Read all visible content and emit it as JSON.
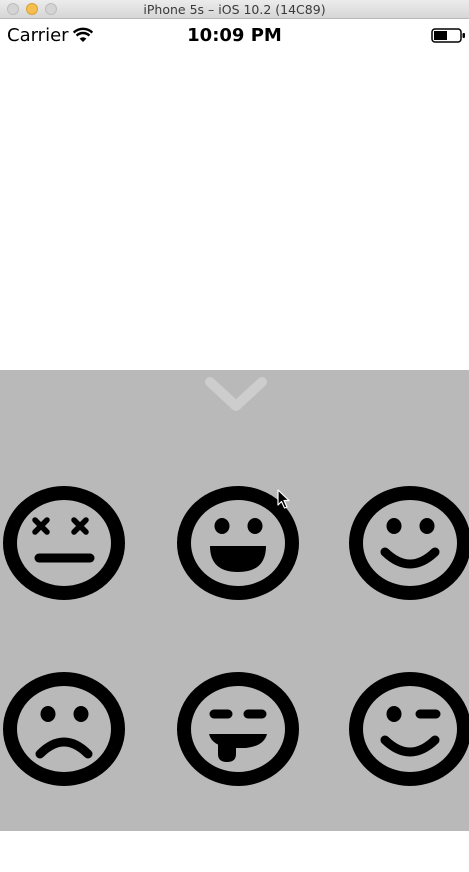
{
  "window": {
    "title": "iPhone 5s – iOS 10.2 (14C89)"
  },
  "status_bar": {
    "carrier": "Carrier",
    "time": "10:09 PM",
    "wifi_icon": "wifi-icon",
    "battery_icon": "battery-icon"
  },
  "picker": {
    "background_color": "#b9b9b9",
    "collapse_icon": "chevron-down-icon",
    "emojis": [
      {
        "name": "dizzy-face-icon"
      },
      {
        "name": "grinning-face-icon"
      },
      {
        "name": "smiling-face-icon"
      },
      {
        "name": "frowning-face-icon"
      },
      {
        "name": "tongue-out-face-icon"
      },
      {
        "name": "winking-face-icon"
      }
    ]
  }
}
